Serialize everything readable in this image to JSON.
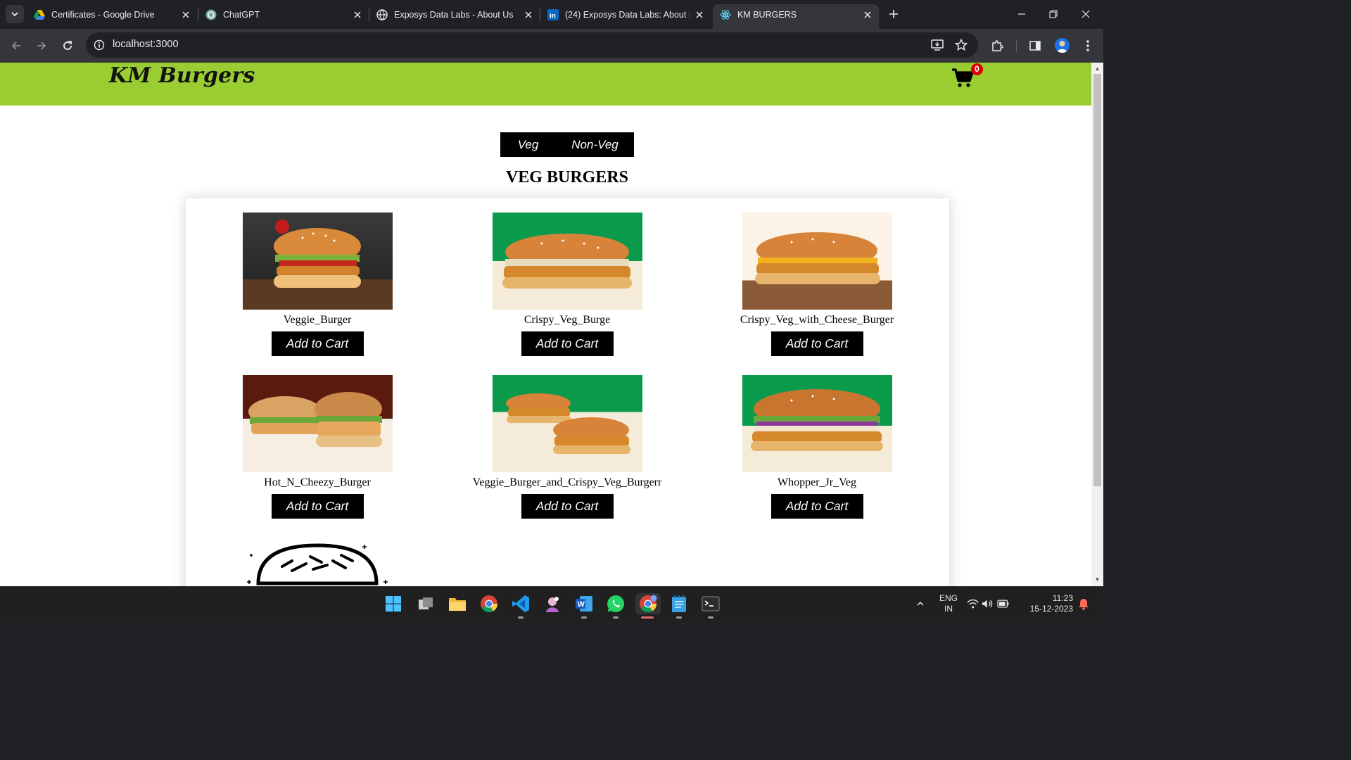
{
  "browser": {
    "tabs": [
      {
        "title": "Certificates - Google Drive",
        "icon": "google-drive-icon"
      },
      {
        "title": "ChatGPT",
        "icon": "chatgpt-icon"
      },
      {
        "title": "Exposys Data Labs - About Us",
        "icon": "globe-icon"
      },
      {
        "title": "(24) Exposys Data Labs: About |",
        "icon": "linkedin-icon"
      },
      {
        "title": "KM BURGERS",
        "icon": "react-icon",
        "active": true
      }
    ],
    "url": "localhost:3000"
  },
  "page": {
    "brand": "KM Burgers",
    "cart_count": "0",
    "toggle": {
      "veg": "Veg",
      "nonveg": "Non-Veg"
    },
    "section_title": "VEG BURGERS",
    "items": [
      {
        "name": "Veggie_Burger",
        "button": "Add to Cart",
        "bg": "#2a2a2a"
      },
      {
        "name": "Crispy_Veg_Burge",
        "button": "Add to Cart",
        "bg": "#0a9a4c"
      },
      {
        "name": "Crispy_Veg_with_Cheese_Burger",
        "button": "Add to Cart",
        "bg": "#f2e4cf"
      },
      {
        "name": "Hot_N_Cheezy_Burger",
        "button": "Add to Cart",
        "bg": "#5a1a0e"
      },
      {
        "name": "Veggie_Burger_and_Crispy_Veg_Burgerr",
        "button": "Add to Cart",
        "bg": "#0a9a4c"
      },
      {
        "name": "Whopper_Jr_Veg",
        "button": "Add to Cart",
        "bg": "#0a9a4c"
      }
    ]
  },
  "taskbar": {
    "apps": [
      "windows-start-icon",
      "task-view-icon",
      "file-explorer-icon",
      "chrome-icon",
      "vscode-icon",
      "app-icon",
      "word-icon",
      "whatsapp-icon",
      "chrome-profile-icon",
      "notepad-icon",
      "terminal-icon"
    ],
    "lang_top": "ENG",
    "lang_bottom": "IN",
    "time": "11:23",
    "date": "15-12-2023"
  },
  "colors": {
    "header_green": "#9acd32",
    "cart_badge": "#e00000",
    "button_black": "#000000"
  }
}
